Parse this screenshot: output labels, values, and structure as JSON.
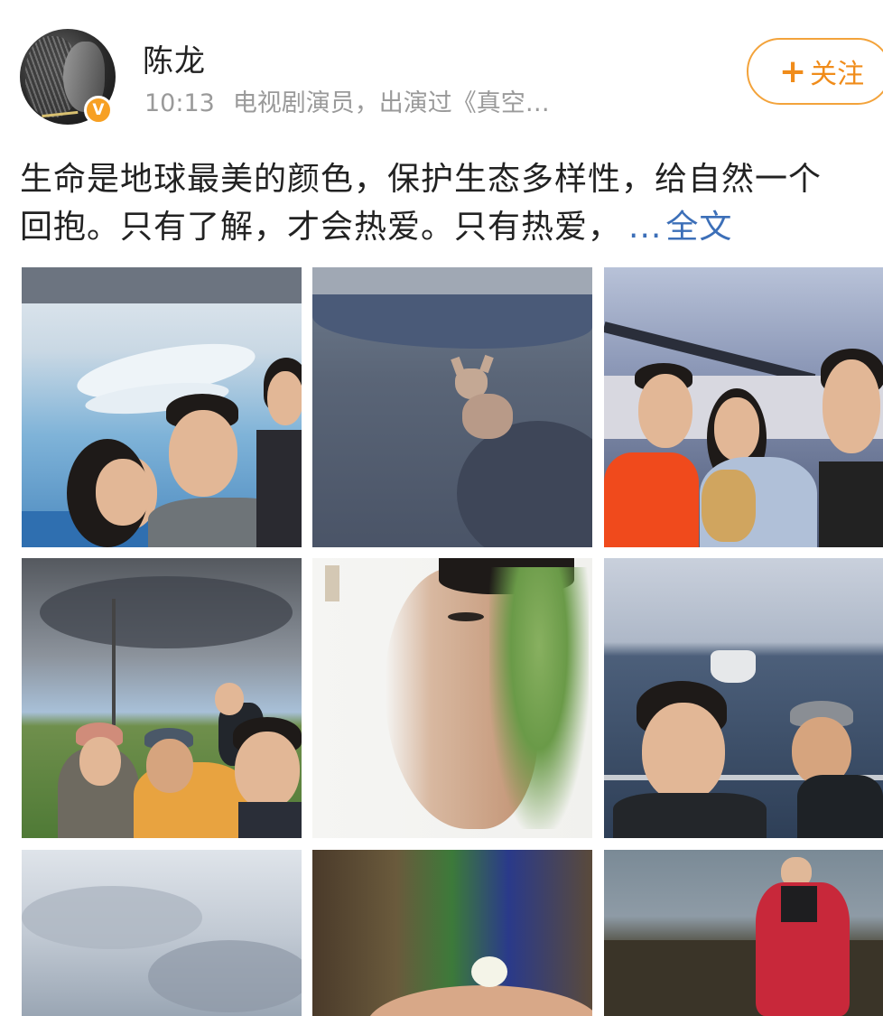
{
  "user": {
    "name": "陈龙",
    "verified_badge": "V",
    "time": "10:13",
    "description": "电视剧演员，出演过《真空…"
  },
  "follow_button": {
    "plus": "+",
    "label": "关注"
  },
  "post": {
    "line1": "生命是地球最美的颜色，保护生态多样性，给自然一个",
    "line2": "回抱。只有了解，才会热爱。只有热爱，",
    "ellipsis": "...",
    "more": "全文"
  },
  "photos": [
    {
      "icon": "aquarium-selfie-photo"
    },
    {
      "icon": "fox-photo"
    },
    {
      "icon": "bridge-selfie-photo"
    },
    {
      "icon": "grassland-group-photo"
    },
    {
      "icon": "face-art-photo"
    },
    {
      "icon": "sea-boat-selfie-photo"
    },
    {
      "icon": "cloudy-sky-photo"
    },
    {
      "icon": "flower-hand-photo"
    },
    {
      "icon": "red-coat-photo"
    }
  ],
  "colors": {
    "follow_orange": "#f08c1a",
    "link_blue": "#3c6fb8",
    "verified_orange": "#f7a023"
  }
}
